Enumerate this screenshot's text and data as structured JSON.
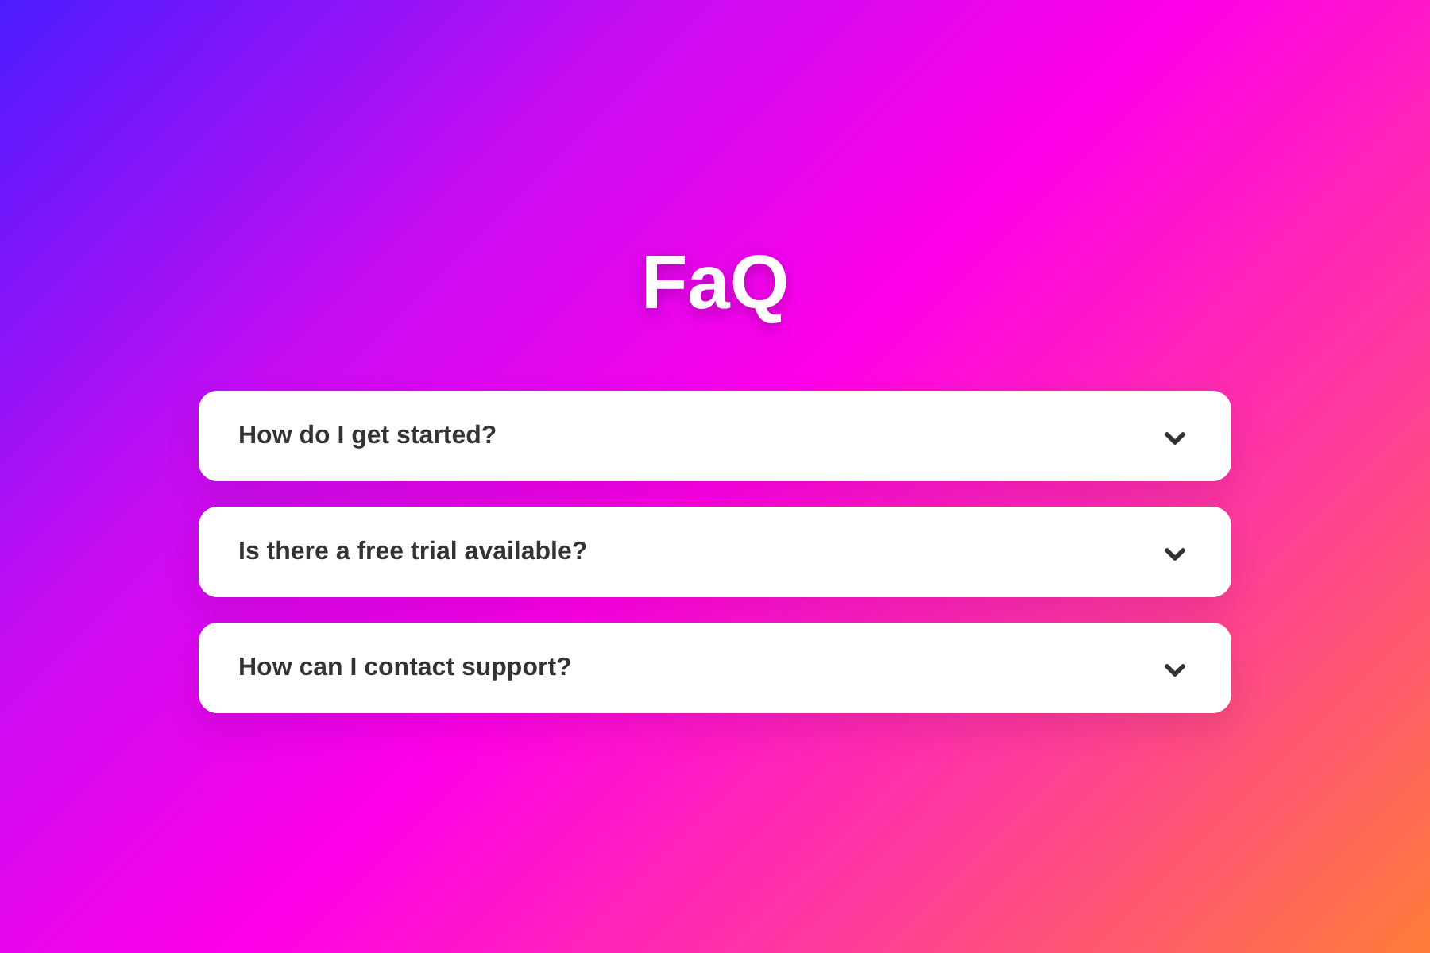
{
  "title": "FaQ",
  "items": [
    {
      "question": "How do I get started?",
      "expanded": false
    },
    {
      "question": "Is there a free trial available?",
      "expanded": false
    },
    {
      "question": "How can I contact support?",
      "expanded": false
    }
  ]
}
